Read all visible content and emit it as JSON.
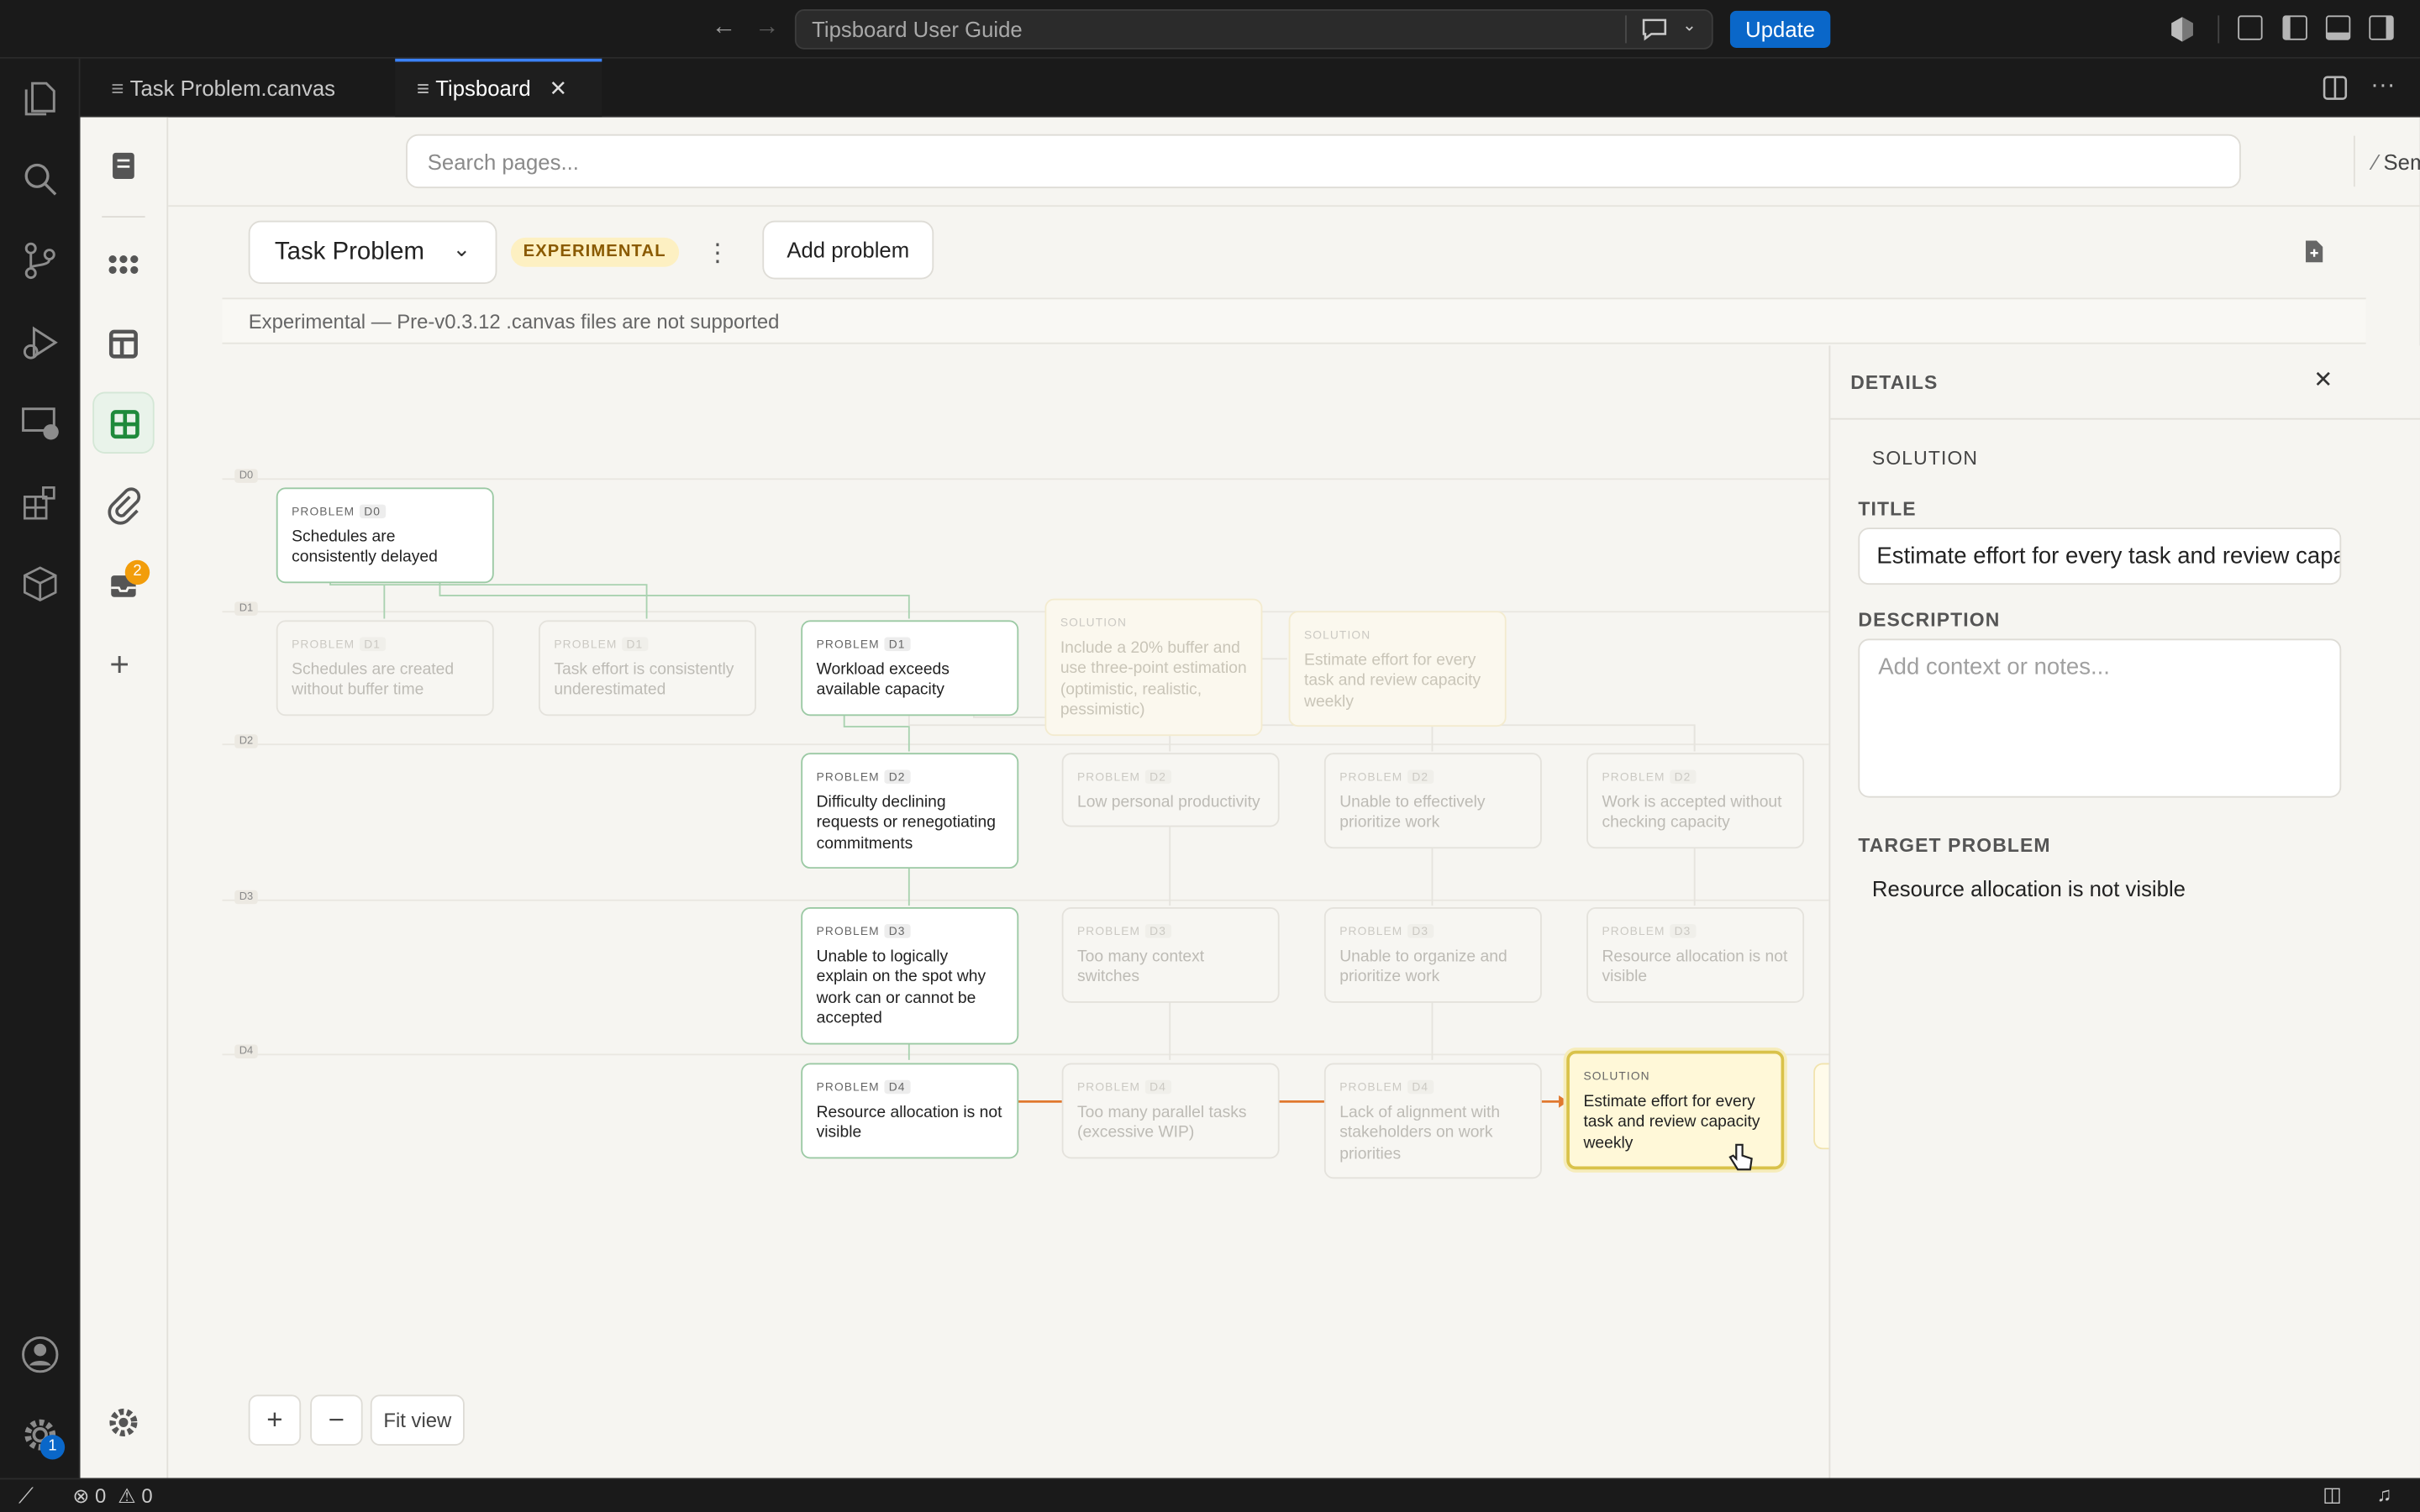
{
  "titlebar": {
    "command_text": "Tipsboard User Guide",
    "update_label": "Update"
  },
  "tabs": [
    {
      "label": "Task Problem.canvas"
    },
    {
      "label": "Tipsboard"
    }
  ],
  "activity": {
    "inbox_badge": "2",
    "settings_badge": "1"
  },
  "search": {
    "placeholder": "Search pages...",
    "semantic_label": "Semantic"
  },
  "toolbar": {
    "problem_select": "Task Problem",
    "experimental_badge": "EXPERIMENTAL",
    "add_problem_label": "Add problem"
  },
  "banner": "Experimental — Pre-v0.3.12 .canvas files are not supported",
  "levels": [
    "D0",
    "D1",
    "D2",
    "D3",
    "D4"
  ],
  "nodes": {
    "n0": {
      "tag": "PROBLEM",
      "level": "D0",
      "text": "Schedules are consistently delayed"
    },
    "n1": {
      "tag": "PROBLEM",
      "level": "D1",
      "text": "Schedules are created without buffer time"
    },
    "n2": {
      "tag": "PROBLEM",
      "level": "D1",
      "text": "Task effort is consistently underestimated"
    },
    "n3": {
      "tag": "PROBLEM",
      "level": "D1",
      "text": "Workload exceeds available capacity"
    },
    "n4": {
      "tag": "SOLUTION",
      "text": "Include a 20% buffer and use three-point estimation (optimistic, realistic, pessimistic)"
    },
    "n5": {
      "tag": "SOLUTION",
      "text": "Estimate effort for every task and review capacity weekly"
    },
    "n6": {
      "tag": "PROBLEM",
      "level": "D2",
      "text": "Difficulty declining requests or renegotiating commitments"
    },
    "n7": {
      "tag": "PROBLEM",
      "level": "D2",
      "text": "Low personal productivity"
    },
    "n8": {
      "tag": "PROBLEM",
      "level": "D2",
      "text": "Unable to effectively prioritize work"
    },
    "n9": {
      "tag": "PROBLEM",
      "level": "D2",
      "text": "Work is accepted without checking capacity"
    },
    "n10": {
      "tag": "PROBLEM",
      "level": "D3",
      "text": "Unable to logically explain on the spot why work can or cannot be accepted"
    },
    "n11": {
      "tag": "PROBLEM",
      "level": "D3",
      "text": "Too many context switches"
    },
    "n12": {
      "tag": "PROBLEM",
      "level": "D3",
      "text": "Unable to organize and prioritize work"
    },
    "n13": {
      "tag": "PROBLEM",
      "level": "D3",
      "text": "Resource allocation is not visible"
    },
    "n14": {
      "tag": "PROBLEM",
      "level": "D4",
      "text": "Resource allocation is not visible"
    },
    "n15": {
      "tag": "PROBLEM",
      "level": "D4",
      "text": "Too many parallel tasks (excessive WIP)"
    },
    "n16": {
      "tag": "PROBLEM",
      "level": "D4",
      "text": "Lack of alignment with stakeholders on work priorities"
    },
    "n17": {
      "tag": "SOLUTION",
      "text": "Estimate effort for every task and review capacity weekly"
    }
  },
  "zoom": {
    "fit_label": "Fit view"
  },
  "details": {
    "header": "DETAILS",
    "kind": "SOLUTION",
    "title_label": "TITLE",
    "title_value": "Estimate effort for every task and review capacity weekly",
    "description_label": "DESCRIPTION",
    "description_placeholder": "Add context or notes...",
    "target_label": "TARGET PROBLEM",
    "target_value": "Resource allocation is not visible"
  },
  "status": {
    "errors": "0",
    "warnings": "0"
  }
}
